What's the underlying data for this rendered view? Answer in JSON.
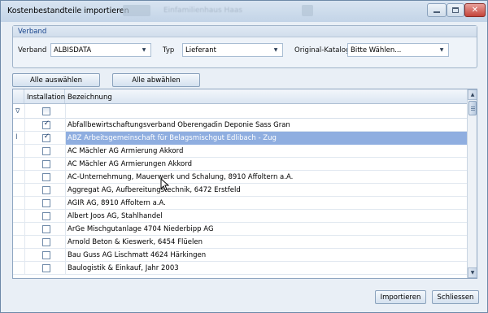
{
  "window": {
    "title": "Kostenbestandteile importieren",
    "background_title": "Einfamilienhaus Haas"
  },
  "verband_group": {
    "title": "Verband",
    "verband_label": "Verband",
    "verband_value": "ALBISDATA",
    "typ_label": "Typ",
    "typ_value": "Lieferant",
    "katalog_label": "Original-Katalog",
    "katalog_value": "Bitte Wählen..."
  },
  "buttons": {
    "select_all": "Alle auswählen",
    "deselect_all": "Alle abwählen",
    "import": "Importieren",
    "close": "Schliessen"
  },
  "grid": {
    "columns": [
      "Installation",
      "Bezeichnung"
    ],
    "rows": [
      {
        "checked": true,
        "name": "Abfallbewirtschaftungsverband Oberengadin  Deponie Sass Gran"
      },
      {
        "checked": true,
        "name": "ABZ Arbeitsgemeinschaft für Belagsmischgut Edlibach -  Zug",
        "selected": true
      },
      {
        "checked": false,
        "name": "AC Mächler AG Armierung Akkord"
      },
      {
        "checked": false,
        "name": "AC Mächler AG Armierungen Akkord"
      },
      {
        "checked": false,
        "name": "AC-Unternehmung, Mauerwerk und Schalung, 8910 Affoltern a.A."
      },
      {
        "checked": false,
        "name": "Aggregat AG, Aufbereitungstechnik, 6472 Erstfeld"
      },
      {
        "checked": false,
        "name": "AGIR AG, 8910 Affoltern a.A."
      },
      {
        "checked": false,
        "name": "Albert Joos AG, Stahlhandel"
      },
      {
        "checked": false,
        "name": "ArGe Mischgutanlage 4704 Niederbipp AG"
      },
      {
        "checked": false,
        "name": "Arnold Beton & Kieswerk, 6454 Flüelen"
      },
      {
        "checked": false,
        "name": "Bau Guss AG Lischmatt 4624 Härkingen"
      },
      {
        "checked": false,
        "name": "Baulogistik & Einkauf, Jahr 2003"
      }
    ]
  },
  "colors": {
    "selection": "#8faee0",
    "header_text": "#15428b"
  }
}
